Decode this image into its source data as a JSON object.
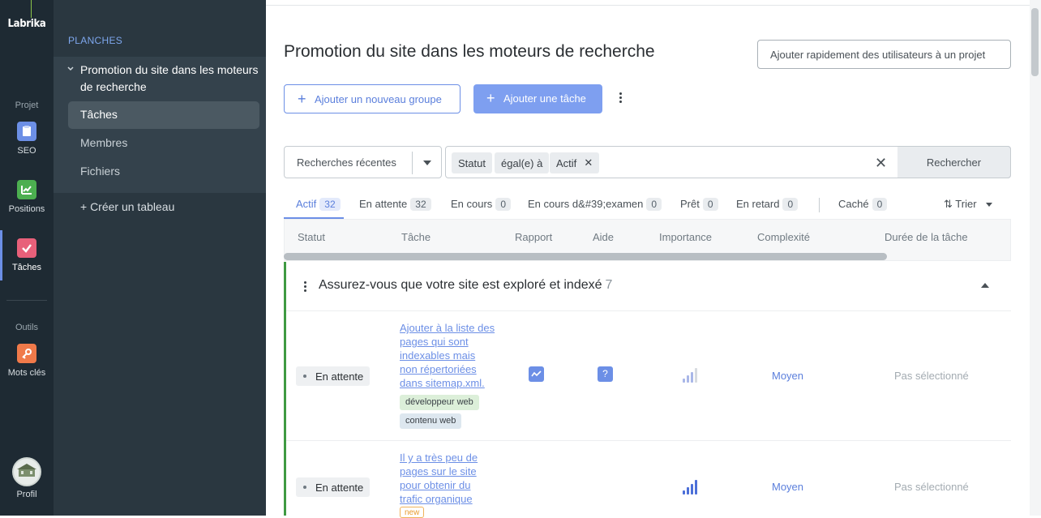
{
  "rail": {
    "logo": "Labrika",
    "project_label": "Projet",
    "tools_label": "Outils",
    "items": [
      {
        "label": "SEO",
        "icon": "clipboard-icon",
        "color": "#6c8fe6"
      },
      {
        "label": "Positions",
        "icon": "chart-icon",
        "color": "#4caf50"
      },
      {
        "label": "Tâches",
        "icon": "check-icon",
        "color": "#e8607a"
      },
      {
        "label": "Mots clés",
        "icon": "key-icon",
        "color": "#f07a4a"
      }
    ],
    "profile_label": "Profil"
  },
  "sidebar": {
    "title": "PLANCHES",
    "board_name": "Promotion du site dans les moteurs de recherche",
    "items": [
      {
        "label": "Tâches"
      },
      {
        "label": "Membres"
      },
      {
        "label": "Fichiers"
      }
    ],
    "create_label": "+ Créer un tableau"
  },
  "header": {
    "title": "Promotion du site dans les moteurs de recherche",
    "quick_add_label": "Ajouter rapidement des utilisateurs à un projet",
    "add_group_label": "Ajouter un nouveau groupe",
    "add_task_label": "Ajouter une tâche"
  },
  "filters": {
    "recent_label": "Recherches récentes",
    "chips": [
      "Statut",
      "égal(e) à",
      "Actif"
    ],
    "search_label": "Rechercher"
  },
  "tabs": [
    {
      "label": "Actif",
      "count": "32"
    },
    {
      "label": "En attente",
      "count": "32"
    },
    {
      "label": "En cours",
      "count": "0"
    },
    {
      "label": "En cours d&#39;examen",
      "count": "0"
    },
    {
      "label": "Prêt",
      "count": "0"
    },
    {
      "label": "En retard",
      "count": "0"
    },
    {
      "label": "Caché",
      "count": "0"
    }
  ],
  "sort_label": "Trier",
  "columns": [
    "Statut",
    "Tâche",
    "Rapport",
    "Aide",
    "Importance",
    "Complexité",
    "Durée de la tâche"
  ],
  "group": {
    "title": "Assurez-vous que votre site est exploré et indexé",
    "count": "7",
    "accent": "#3f9a42"
  },
  "rows": [
    {
      "status": "En attente",
      "task": "Ajouter à la liste des pages qui sont indexables mais non répertoriées dans sitemap.xml.",
      "tags": [
        "développeur web",
        "contenu web"
      ],
      "has_report": true,
      "has_help": true,
      "importance_level": 3,
      "complexity": "Moyen",
      "duration": "Pas sélectionné"
    },
    {
      "status": "En attente",
      "task": "Il y a très peu de pages sur le site pour obtenir du trafic organique",
      "tags": [
        "new"
      ],
      "has_report": false,
      "has_help": false,
      "importance_level": 4,
      "complexity": "Moyen",
      "duration": "Pas sélectionné"
    }
  ]
}
